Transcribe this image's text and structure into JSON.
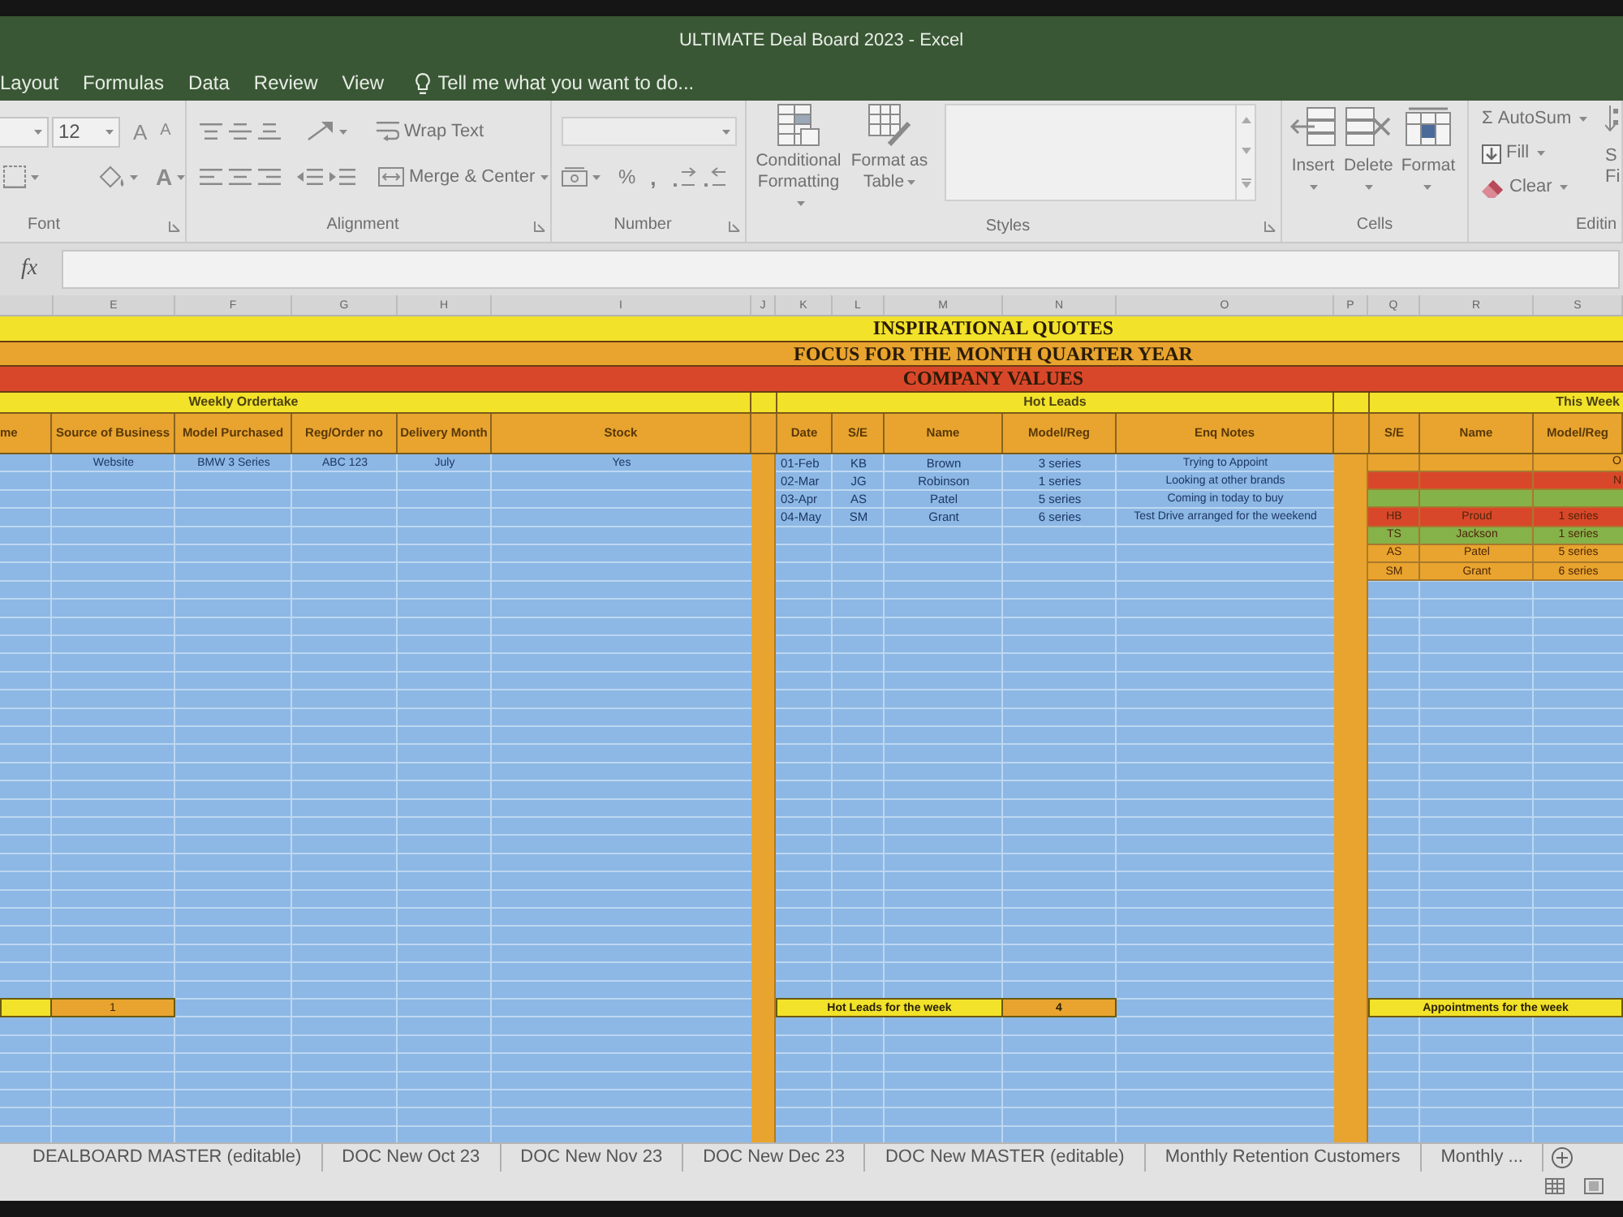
{
  "window": {
    "title": "ULTIMATE Deal Board 2023 - Excel"
  },
  "menu_tabs": [
    {
      "label": "Layout",
      "selected": false
    },
    {
      "label": "Formulas",
      "selected": false
    },
    {
      "label": "Data",
      "selected": false
    },
    {
      "label": "Review",
      "selected": false
    },
    {
      "label": "View",
      "selected": false
    }
  ],
  "tell_me": {
    "placeholder": "Tell me what you want to do..."
  },
  "ribbon": {
    "font": {
      "label": "Font",
      "size": "12",
      "grow": "A",
      "shrink": "A",
      "tint_letter": "A"
    },
    "alignment": {
      "label": "Alignment",
      "wrap_text": "Wrap Text",
      "merge_center": "Merge & Center"
    },
    "number": {
      "label": "Number",
      "percent": "%",
      "comma": ","
    },
    "styles": {
      "label": "Styles",
      "conditional_formatting": "Conditional Formatting",
      "format_as_table": "Format as Table"
    },
    "cells": {
      "label": "Cells",
      "buttons": [
        "Insert",
        "Delete",
        "Format"
      ]
    },
    "editing": {
      "label": "Editin",
      "autosum": "Σ AutoSum",
      "fill": "Fill",
      "clear": "Clear",
      "sort_filter": [
        "S",
        "Fi"
      ]
    }
  },
  "formula_bar": {
    "function_label": "fx"
  },
  "column_headers": [
    "E",
    "F",
    "G",
    "H",
    "I",
    "J",
    "K",
    "L",
    "M",
    "N",
    "O",
    "P",
    "Q",
    "R",
    "S"
  ],
  "banners": [
    {
      "text": "INSPIRATIONAL QUOTES",
      "color": "#f2e22a"
    },
    {
      "text": "FOCUS FOR THE MONTH QUARTER YEAR",
      "color": "#e8a42e"
    },
    {
      "text": "COMPANY VALUES",
      "color": "#d9472a"
    }
  ],
  "weekly_ordertake": {
    "title": "Weekly Ordertake",
    "columns": [
      "me",
      "Source of Business",
      "Model Purchased",
      "Reg/Order no",
      "Delivery Month",
      "Stock"
    ],
    "rows": [
      {
        "cells": [
          "",
          "Website",
          "BMW 3 Series",
          "ABC 123",
          "July",
          "Yes"
        ]
      }
    ],
    "total": "1"
  },
  "hot_leads": {
    "title": "Hot Leads",
    "columns": [
      "Date",
      "S/E",
      "Name",
      "Model/Reg",
      "Enq Notes"
    ],
    "rows": [
      {
        "cells": [
          "01-Feb",
          "KB",
          "Brown",
          "3 series",
          "Trying to Appoint"
        ]
      },
      {
        "cells": [
          "02-Mar",
          "JG",
          "Robinson",
          "1 series",
          "Looking at other brands"
        ]
      },
      {
        "cells": [
          "03-Apr",
          "AS",
          "Patel",
          "5 series",
          "Coming in today to buy"
        ]
      },
      {
        "cells": [
          "04-May",
          "SM",
          "Grant",
          "6 series",
          "Test Drive arranged for the weekend"
        ]
      }
    ],
    "total_label": "Hot Leads for the week",
    "total": "4"
  },
  "this_week": {
    "title": "This Week",
    "columns": [
      "S/E",
      "Name",
      "Model/Reg"
    ],
    "rows": [
      {
        "kind": "band",
        "color": "#e8a42e",
        "note": "O"
      },
      {
        "kind": "band",
        "color": "#d9472a",
        "note": "N"
      },
      {
        "kind": "band",
        "color": "#86b24a"
      },
      {
        "kind": "lead",
        "color": "#d9472a",
        "cells": [
          "HB",
          "Proud",
          "1 series"
        ]
      },
      {
        "kind": "lead",
        "color": "#86b24a",
        "cells": [
          "TS",
          "Jackson",
          "1 series"
        ]
      },
      {
        "kind": "lead",
        "color": "#e8a42e",
        "cells": [
          "AS",
          "Patel",
          "5 series"
        ]
      },
      {
        "kind": "lead",
        "color": "#e8a42e",
        "cells": [
          "SM",
          "Grant",
          "6 series"
        ]
      }
    ],
    "total_label": "Appointments for the week"
  },
  "sheet_tabs": [
    {
      "label": "DEALBOARD MASTER (editable)",
      "selected": false
    },
    {
      "label": "DOC New Oct 23",
      "selected": false
    },
    {
      "label": "DOC New Nov 23",
      "selected": false
    },
    {
      "label": "DOC New Dec 23",
      "selected": false
    },
    {
      "label": "DOC New MASTER (editable)",
      "selected": false
    },
    {
      "label": "Monthly Retention Customers",
      "selected": false
    },
    {
      "label": "Monthly ...",
      "selected": false
    }
  ]
}
